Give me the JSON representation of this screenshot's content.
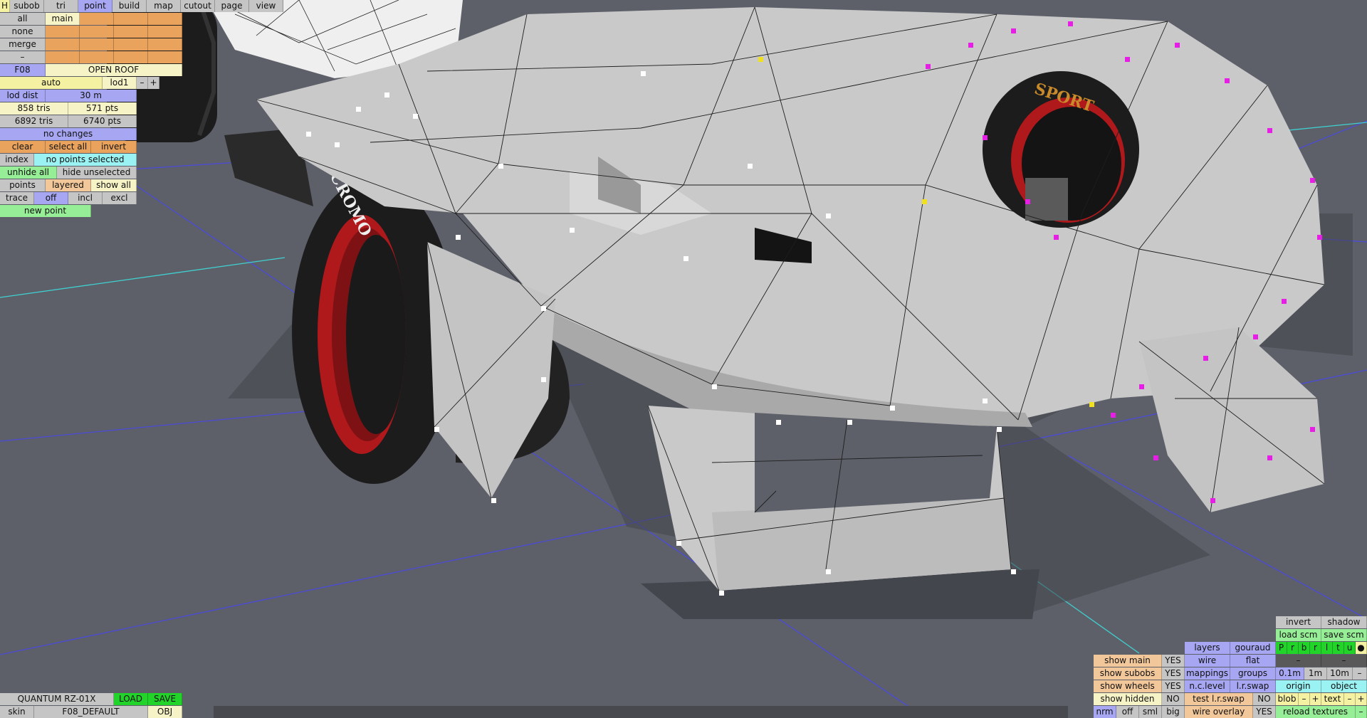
{
  "top_tabs": {
    "h": "H",
    "subob": "subob",
    "tri": "tri",
    "point": "point",
    "build": "build",
    "map": "map",
    "cutout": "cutout",
    "page": "page",
    "view": "view"
  },
  "selection": {
    "all": "all",
    "main": "main",
    "none": "none",
    "merge": "merge",
    "dash": "–"
  },
  "model": {
    "id": "F08",
    "name": "OPEN ROOF"
  },
  "lod": {
    "auto": "auto",
    "lod1": "lod1",
    "minus": "–",
    "plus": "+",
    "dist_label": "lod dist",
    "dist_value": "30 m",
    "tris1": "858 tris",
    "pts1": "571 pts",
    "tris2": "6892 tris",
    "pts2": "6740 pts",
    "changes": "no changes"
  },
  "point_tools": {
    "clear": "clear",
    "select_all": "select all",
    "invert": "invert",
    "index": "index",
    "index_status": "no points selected",
    "unhide_all": "unhide all",
    "hide_unselected": "hide unselected",
    "points": "points",
    "layered": "layered",
    "show_all": "show all",
    "trace": "trace",
    "off": "off",
    "incl": "incl",
    "excl": "excl",
    "new_point": "new point"
  },
  "bottom_left": {
    "car_name": "QUANTUM RZ-01X",
    "load": "LOAD",
    "save": "SAVE",
    "skin": "skin",
    "skin_name": "F08_DEFAULT",
    "obj": "OBJ"
  },
  "view_panel": {
    "invert": "invert",
    "shadow": "shadow",
    "load_scm": "load scm",
    "save_scm": "save scm",
    "layers": "layers",
    "gouraud": "gouraud",
    "layer_letters": [
      "P",
      "r",
      "b",
      "r",
      "l",
      "t",
      "u"
    ],
    "dot": "●",
    "dash": "–",
    "show_main": "show main",
    "show_main_val": "YES",
    "wire": "wire",
    "flat": "flat",
    "show_subobs": "show subobs",
    "show_subobs_val": "YES",
    "mappings": "mappings",
    "groups": "groups",
    "d01": "0.1m",
    "d1": "1m",
    "d10": "10m",
    "show_wheels": "show wheels",
    "show_wheels_val": "YES",
    "nc_level": "n.c.level",
    "lr_swap": "l.r.swap",
    "origin": "origin",
    "object": "object",
    "show_hidden": "show hidden",
    "show_hidden_val": "NO",
    "test_lr_swap": "test l.r.swap",
    "test_val": "NO",
    "blob": "blob",
    "text": "text",
    "plus": "+",
    "nrm": "nrm",
    "off": "off",
    "sml": "sml",
    "big": "big",
    "wire_overlay": "wire overlay",
    "wire_overlay_val": "YES",
    "reload_textures": "reload textures"
  },
  "tyre_labels": {
    "front": "CROMO",
    "rear": "SPORT"
  },
  "colors": {
    "background": "#5d6069",
    "body": "#c9c9c9",
    "rim": "#b0191c",
    "tyre": "#1c1c1c",
    "selected_points": "#e61ee6",
    "grid_line": "#4b4bd8",
    "axis_line": "#3fd0d0"
  }
}
